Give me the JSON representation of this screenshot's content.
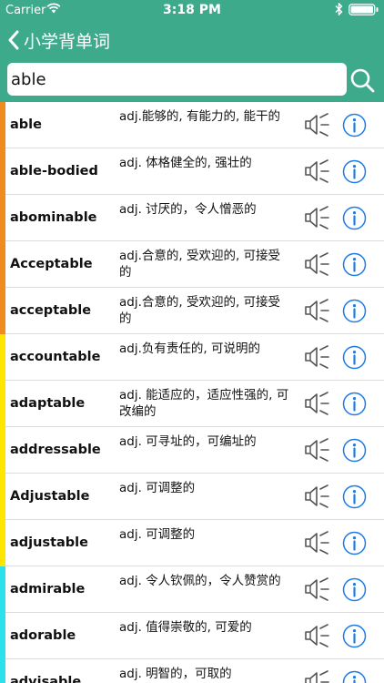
{
  "status_bar": {
    "carrier": "Carrier",
    "time": "3:18 PM",
    "wifi_icon": "wifi-icon",
    "bluetooth_icon": "bluetooth-icon",
    "battery_icon": "battery-icon"
  },
  "nav": {
    "back_icon": "chevron-left-icon",
    "title": "小学背单词"
  },
  "search": {
    "value": "able",
    "placeholder": "",
    "icon": "search-icon"
  },
  "colors": {
    "header": "#3daa8c",
    "text": "#111111",
    "icon_blue": "#1e7be6",
    "speaker": "#555555",
    "bars": [
      "#f08c1e",
      "#f08c1e",
      "#f08c1e",
      "#f08c1e",
      "#f08c1e",
      "#ffe600",
      "#ffe600",
      "#ffe600",
      "#ffe600",
      "#ffe600",
      "#2ce0ec",
      "#2ce0ec",
      "#2ce0ec"
    ]
  },
  "row_icons": {
    "speaker": "speaker-icon",
    "info": "info-icon"
  },
  "words": [
    {
      "word": "able",
      "meaning": "adj.能够的, 有能力的, 能干的"
    },
    {
      "word": "able-bodied",
      "meaning": "adj. 体格健全的, 强壮的"
    },
    {
      "word": "abominable",
      "meaning": "adj. 讨厌的，令人憎恶的"
    },
    {
      "word": "Acceptable",
      "meaning": "adj.合意的, 受欢迎的, 可接受的"
    },
    {
      "word": "acceptable",
      "meaning": "adj.合意的, 受欢迎的, 可接受的"
    },
    {
      "word": "accountable",
      "meaning": "adj.负有责任的, 可说明的"
    },
    {
      "word": "adaptable",
      "meaning": "adj. 能适应的，适应性强的, 可改编的"
    },
    {
      "word": "addressable",
      "meaning": "adj. 可寻址的，可编址的"
    },
    {
      "word": "Adjustable",
      "meaning": "adj. 可调整的"
    },
    {
      "word": "adjustable",
      "meaning": "adj. 可调整的"
    },
    {
      "word": "admirable",
      "meaning": "adj. 令人钦佩的，令人赞赏的"
    },
    {
      "word": "adorable",
      "meaning": "adj. 值得崇敬的, 可爱的"
    },
    {
      "word": "advisable",
      "meaning": "adj. 明智的，可取的"
    }
  ]
}
